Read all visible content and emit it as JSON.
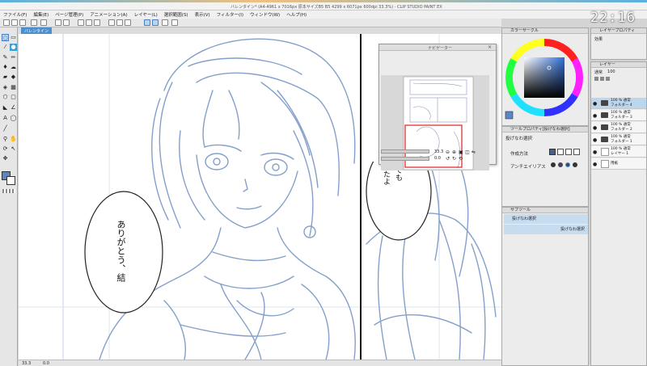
{
  "window": {
    "title": "バレンタイン* (A4-4961 x 7016px 原本サイズB5 B5 4299 x 6071px 600dpi 33.3%) - CLIP STUDIO PAINT EX"
  },
  "menu": [
    "ファイル(F)",
    "編集(E)",
    "ページ管理(P)",
    "アニメーション(A)",
    "レイヤー(L)",
    "選択範囲(S)",
    "表示(V)",
    "フィルター(I)",
    "ウィンドウ(W)",
    "ヘルプ(H)"
  ],
  "clock": "22:16",
  "canvas_tab": "バレンタイン",
  "speech_bubbles": {
    "left": [
      "ありがとう、",
      "結"
    ],
    "right": [
      "てても",
      "ったよ"
    ]
  },
  "navigator": {
    "title": "ナビゲーター",
    "zoom": "33.3",
    "rotation": "0.0"
  },
  "color_panel": {
    "title": "カラーサークル",
    "hue_marker": "#3b78d8",
    "main_color": "#5a86c6",
    "sub_color": "#ffffff"
  },
  "tool_property": {
    "title": "ツールプロパティ[投げなわ選択]",
    "tool_name": "投げなわ選択",
    "mode_label": "作成方法",
    "antialias_label": "アンチエイリアス"
  },
  "sub_tool": {
    "title": "サブツール",
    "items": [
      "投げなわ選択",
      "投げなわ選択"
    ]
  },
  "layer_panel": {
    "title": "レイヤー",
    "blend_mode": "通常",
    "opacity": "100",
    "layers": [
      {
        "name": "100 % 通常",
        "sub": "フォルダー 4",
        "type": "folder",
        "selected": true
      },
      {
        "name": "100 % 通常",
        "sub": "フォルダー 3",
        "type": "folder",
        "selected": false
      },
      {
        "name": "100 % 通常",
        "sub": "フォルダー 2",
        "type": "folder",
        "selected": false
      },
      {
        "name": "100 % 通常",
        "sub": "フォルダー 1",
        "type": "folder",
        "selected": false
      },
      {
        "name": "100 % 通常",
        "sub": "レイヤー 1",
        "type": "raster",
        "selected": false
      },
      {
        "name": "用紙",
        "sub": "",
        "type": "paper",
        "selected": false
      }
    ]
  },
  "layer_property": {
    "title": "レイヤープロパティ",
    "effect_label": "効果"
  },
  "status": {
    "zoom": "33.3",
    "coords": "0.0"
  },
  "colors": {
    "sketch": "#6f8fc0",
    "accent": "#4a8fd0"
  }
}
